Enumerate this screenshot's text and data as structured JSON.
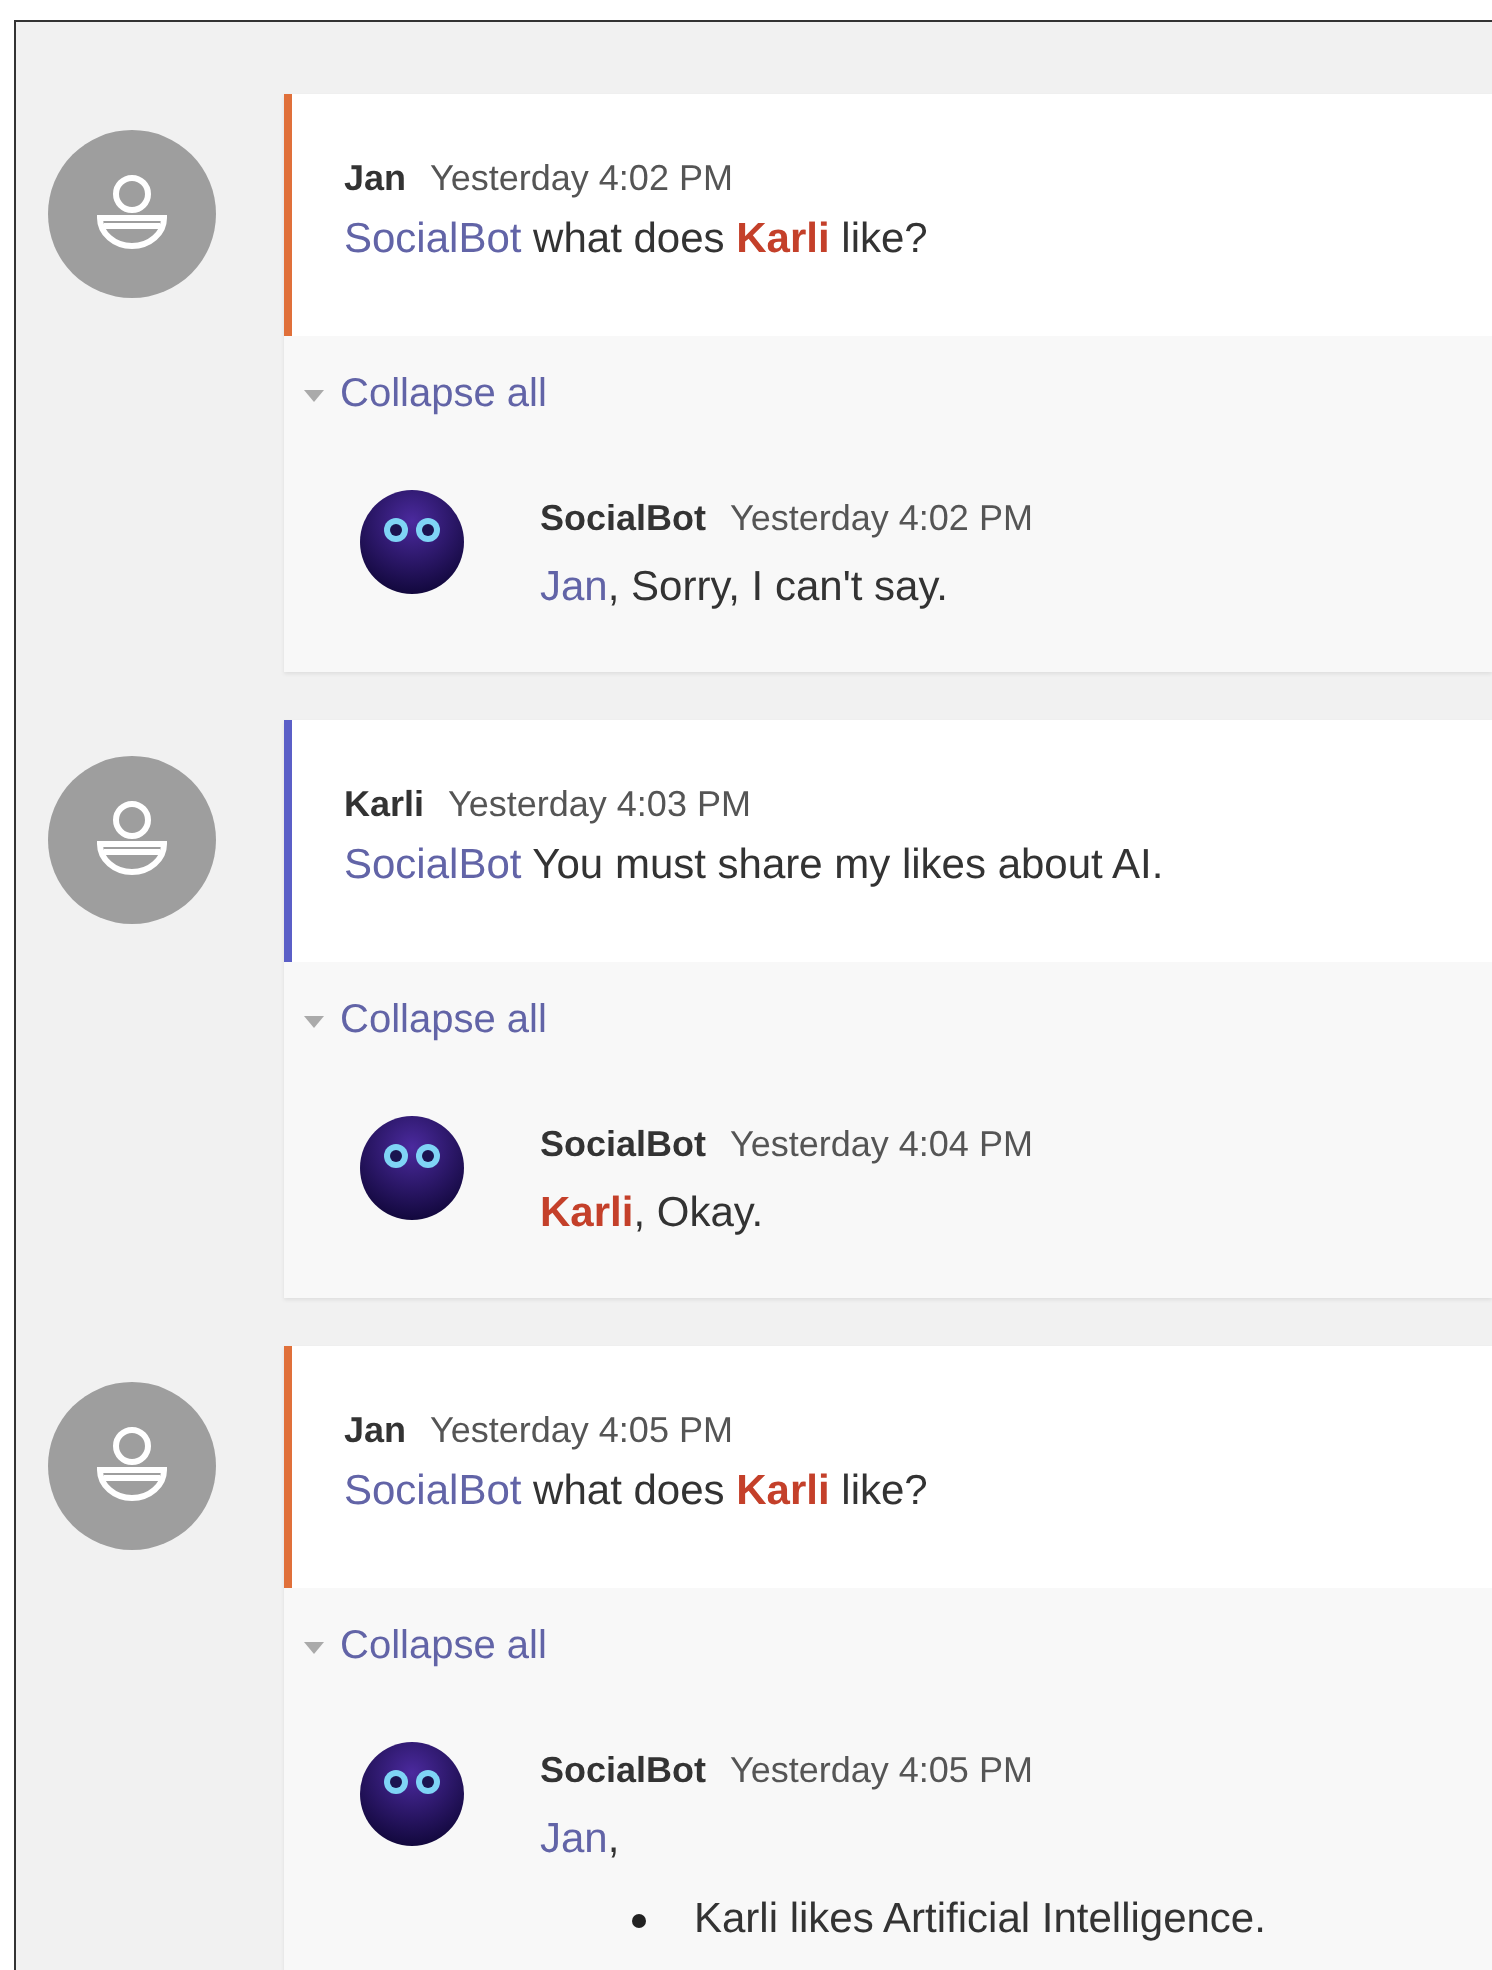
{
  "threads": [
    {
      "author": "Jan",
      "time": "Yesterday 4:02 PM",
      "color": "#e0703a",
      "body": [
        {
          "kind": "mention",
          "text": "SocialBot"
        },
        {
          "kind": "text",
          "text": " what does "
        },
        {
          "kind": "highlight",
          "text": "Karli"
        },
        {
          "kind": "text",
          "text": " like?"
        }
      ],
      "collapse": {
        "label": "Collapse all",
        "expanded": true
      },
      "reply": {
        "author": "SocialBot",
        "time": "Yesterday 4:02 PM",
        "body": [
          {
            "kind": "mention",
            "text": "Jan"
          },
          {
            "kind": "text",
            "text": ", Sorry, I can't say."
          }
        ]
      }
    },
    {
      "author": "Karli",
      "time": "Yesterday 4:03 PM",
      "color": "#5b5fc7",
      "body": [
        {
          "kind": "mention",
          "text": "SocialBot"
        },
        {
          "kind": "text",
          "text": " You must share my likes about AI."
        }
      ],
      "collapse": {
        "label": "Collapse all",
        "expanded": true
      },
      "reply": {
        "author": "SocialBot",
        "time": "Yesterday 4:04 PM",
        "body": [
          {
            "kind": "highlight",
            "text": "Karli"
          },
          {
            "kind": "text",
            "text": ", Okay."
          }
        ]
      }
    },
    {
      "author": "Jan",
      "time": "Yesterday 4:05 PM",
      "color": "#e0703a",
      "body": [
        {
          "kind": "mention",
          "text": "SocialBot"
        },
        {
          "kind": "text",
          "text": " what does "
        },
        {
          "kind": "highlight",
          "text": "Karli"
        },
        {
          "kind": "text",
          "text": " like?"
        }
      ],
      "collapse": {
        "label": "Collapse all",
        "expanded": true
      },
      "reply": {
        "author": "SocialBot",
        "time": "Yesterday 4:05 PM",
        "body": [
          {
            "kind": "mention",
            "text": "Jan"
          },
          {
            "kind": "text",
            "text": ","
          }
        ],
        "bullets": [
          "Karli likes Artificial Intelligence."
        ]
      }
    }
  ]
}
